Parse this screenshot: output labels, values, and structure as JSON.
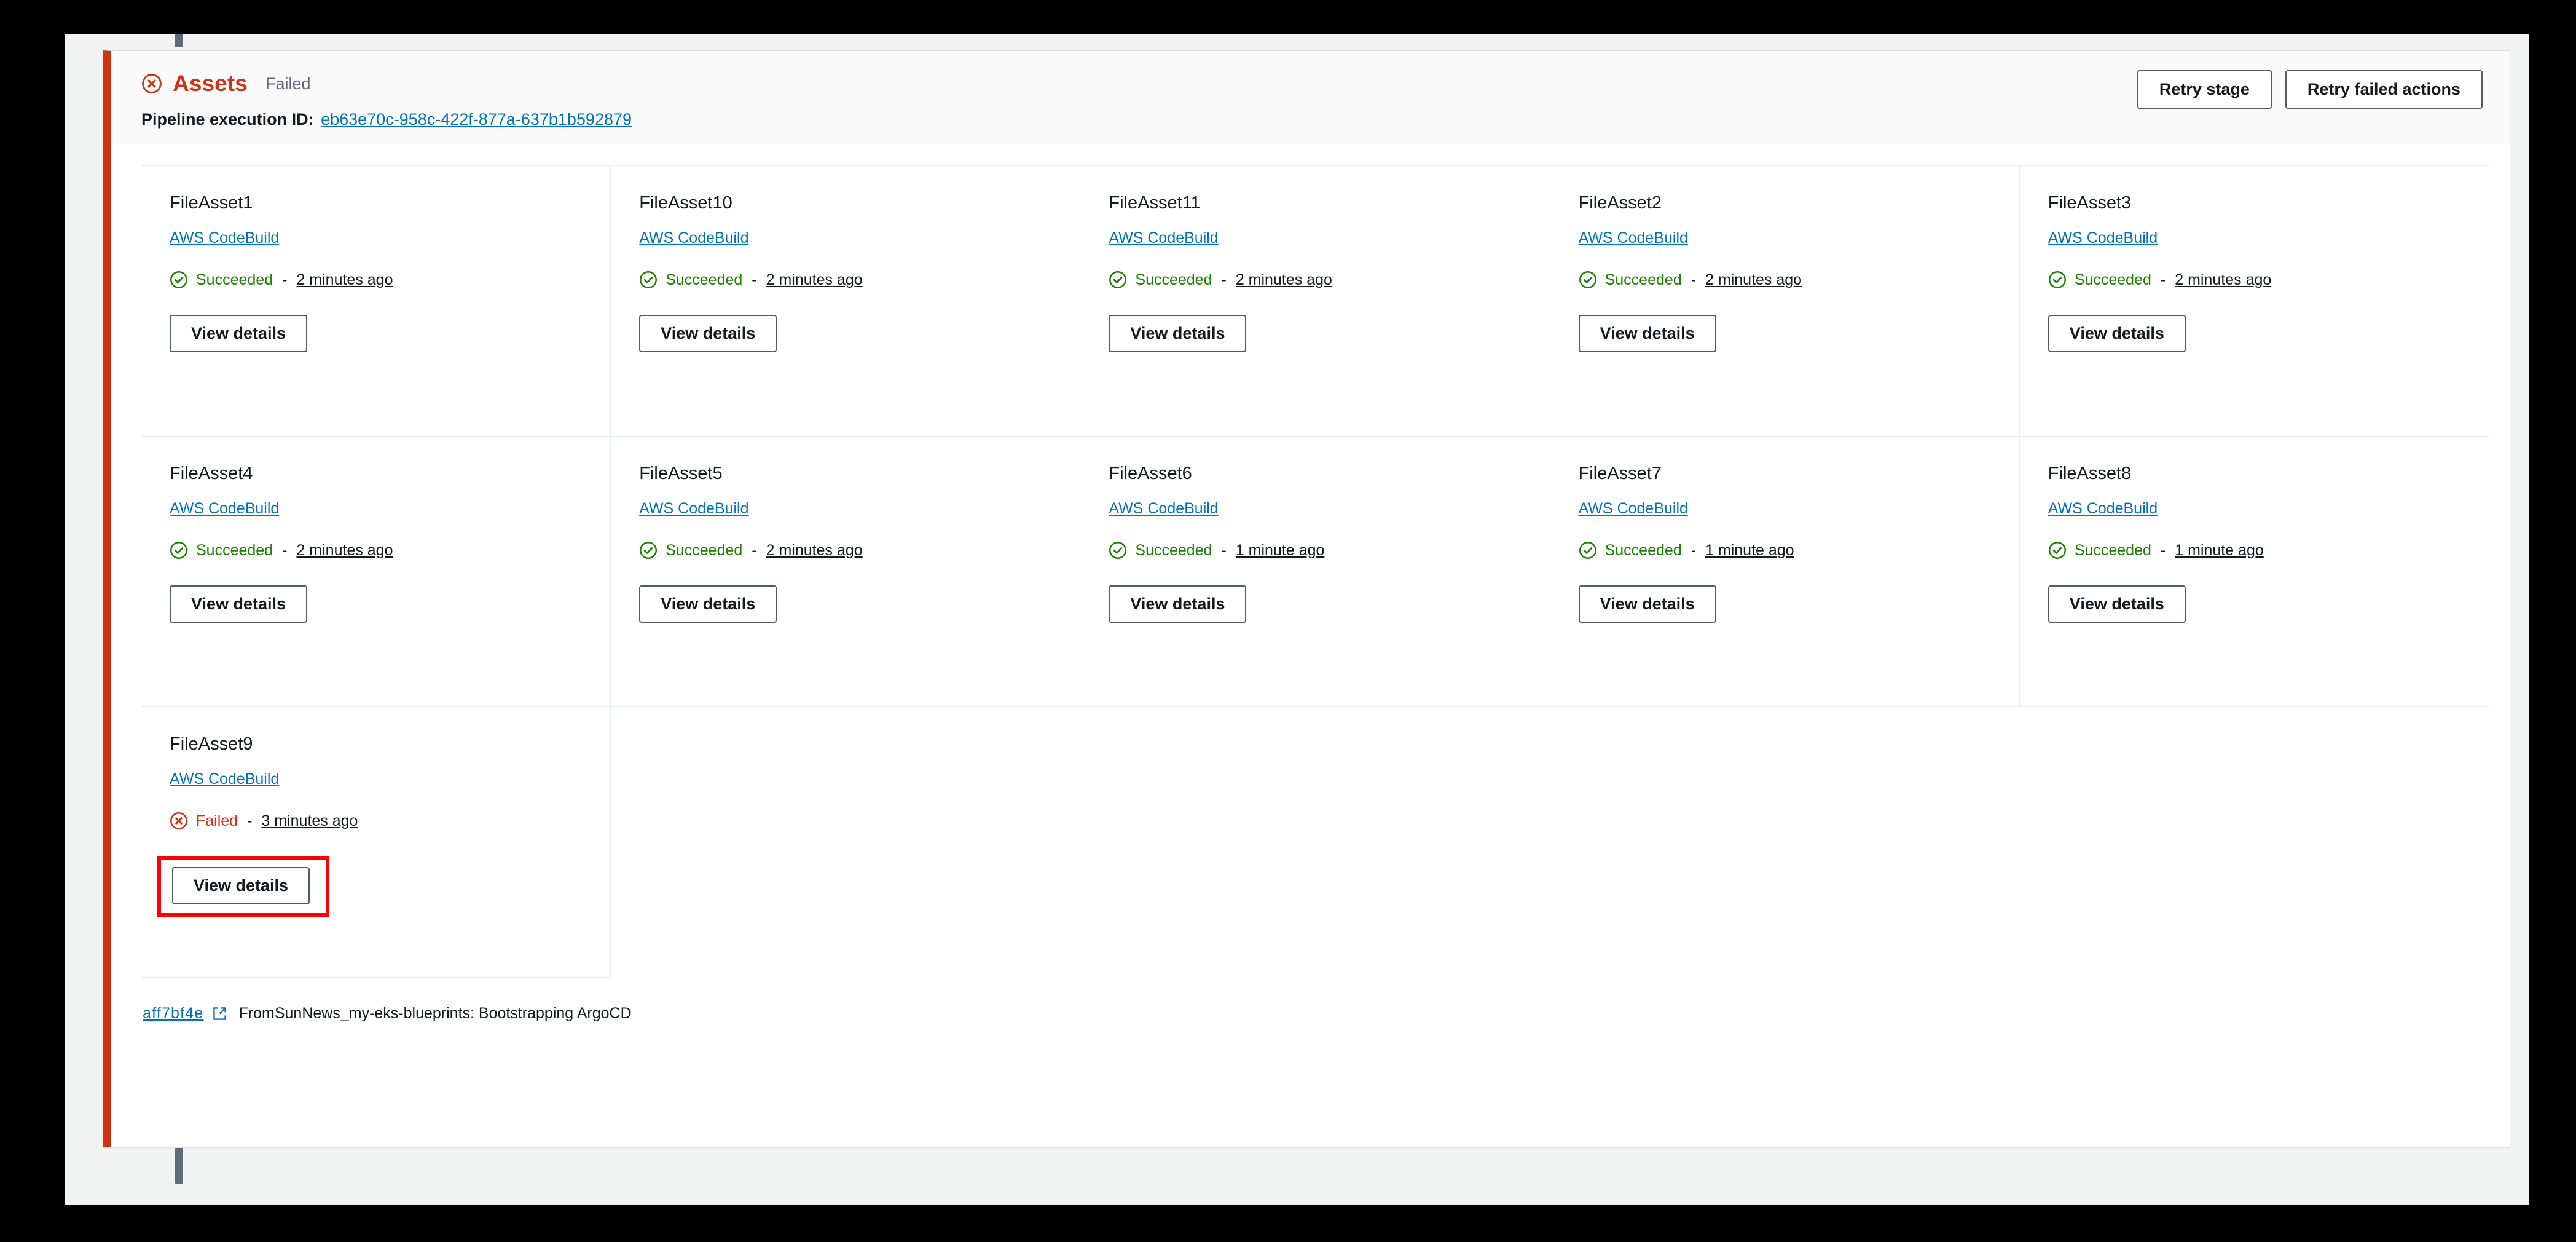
{
  "stage": {
    "title": "Assets",
    "status": "Failed",
    "status_icon": "error-circle-icon",
    "accent_color": "#d13212"
  },
  "execution": {
    "label": "Pipeline execution ID:",
    "id": "eb63e70c-958c-422f-877a-637b1b592879"
  },
  "header_actions": {
    "retry_stage": "Retry stage",
    "retry_failed_actions": "Retry failed actions"
  },
  "common": {
    "provider": "AWS CodeBuild",
    "view_details": "View details",
    "separator": "-",
    "success_color": "#1d8102",
    "failure_color": "#d13212",
    "link_color": "#0073bb"
  },
  "actions": [
    {
      "name": "FileAsset1",
      "provider": "AWS CodeBuild",
      "status": "Succeeded",
      "status_kind": "succeeded",
      "time": "2 minutes ago",
      "button": "View details",
      "highlighted": false
    },
    {
      "name": "FileAsset10",
      "provider": "AWS CodeBuild",
      "status": "Succeeded",
      "status_kind": "succeeded",
      "time": "2 minutes ago",
      "button": "View details",
      "highlighted": false
    },
    {
      "name": "FileAsset11",
      "provider": "AWS CodeBuild",
      "status": "Succeeded",
      "status_kind": "succeeded",
      "time": "2 minutes ago",
      "button": "View details",
      "highlighted": false
    },
    {
      "name": "FileAsset2",
      "provider": "AWS CodeBuild",
      "status": "Succeeded",
      "status_kind": "succeeded",
      "time": "2 minutes ago",
      "button": "View details",
      "highlighted": false
    },
    {
      "name": "FileAsset3",
      "provider": "AWS CodeBuild",
      "status": "Succeeded",
      "status_kind": "succeeded",
      "time": "2 minutes ago",
      "button": "View details",
      "highlighted": false
    },
    {
      "name": "FileAsset4",
      "provider": "AWS CodeBuild",
      "status": "Succeeded",
      "status_kind": "succeeded",
      "time": "2 minutes ago",
      "button": "View details",
      "highlighted": false
    },
    {
      "name": "FileAsset5",
      "provider": "AWS CodeBuild",
      "status": "Succeeded",
      "status_kind": "succeeded",
      "time": "2 minutes ago",
      "button": "View details",
      "highlighted": false
    },
    {
      "name": "FileAsset6",
      "provider": "AWS CodeBuild",
      "status": "Succeeded",
      "status_kind": "succeeded",
      "time": "1 minute ago",
      "button": "View details",
      "highlighted": false
    },
    {
      "name": "FileAsset7",
      "provider": "AWS CodeBuild",
      "status": "Succeeded",
      "status_kind": "succeeded",
      "time": "1 minute ago",
      "button": "View details",
      "highlighted": false
    },
    {
      "name": "FileAsset8",
      "provider": "AWS CodeBuild",
      "status": "Succeeded",
      "status_kind": "succeeded",
      "time": "1 minute ago",
      "button": "View details",
      "highlighted": false
    },
    {
      "name": "FileAsset9",
      "provider": "AWS CodeBuild",
      "status": "Failed",
      "status_kind": "failed",
      "time": "3 minutes ago",
      "button": "View details",
      "highlighted": true
    }
  ],
  "footer": {
    "commit_id": "aff7bf4e",
    "external_link_icon": "external-link-icon",
    "message": "FromSunNews_my-eks-blueprints: Bootstrapping ArgoCD"
  }
}
